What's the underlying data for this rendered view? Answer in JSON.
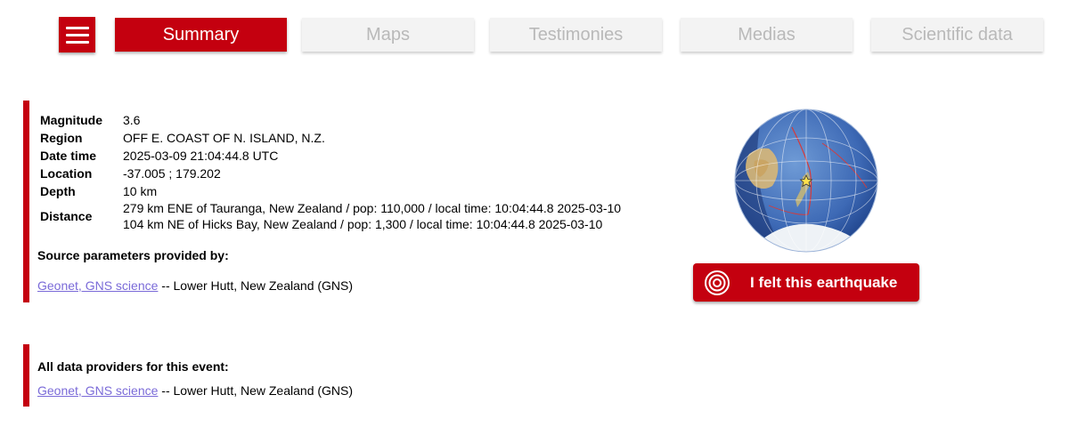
{
  "nav": {
    "tabs": [
      {
        "label": "Summary",
        "active": true
      },
      {
        "label": "Maps",
        "active": false
      },
      {
        "label": "Testimonies",
        "active": false
      },
      {
        "label": "Medias",
        "active": false
      },
      {
        "label": "Scientific data",
        "active": false
      }
    ]
  },
  "event": {
    "rows": [
      {
        "key": "Magnitude",
        "value": "3.6"
      },
      {
        "key": "Region",
        "value": "OFF E. COAST OF N. ISLAND, N.Z."
      },
      {
        "key": "Date time",
        "value": "2025-03-09 21:04:44.8 UTC"
      },
      {
        "key": "Location",
        "value": "-37.005 ; 179.202"
      },
      {
        "key": "Depth",
        "value": "10 km"
      }
    ],
    "distance": {
      "key": "Distance",
      "lines": [
        "279 km ENE of Tauranga, New Zealand / pop: 110,000 / local time: 10:04:44.8 2025-03-10",
        "104 km NE of Hicks Bay, New Zealand / pop: 1,300 / local time: 10:04:44.8 2025-03-10"
      ]
    }
  },
  "source": {
    "title": "Source parameters provided by:",
    "link": "Geonet, GNS science",
    "suffix": " -- Lower Hutt, New Zealand (GNS)"
  },
  "providers": {
    "title": "All data providers for this event:",
    "link": "Geonet, GNS science",
    "suffix": " -- Lower Hutt, New Zealand (GNS)"
  },
  "felt_button": {
    "label": "I felt this earthquake",
    "icon": "concentric-circles-icon"
  },
  "globe": {
    "icon": "globe-map-icon",
    "marker": "star-icon"
  },
  "colors": {
    "accent": "#c4000f",
    "link": "#7a6ad8",
    "inactive_text": "#b9b9b9",
    "inactive_bg": "#f3f3f3"
  }
}
